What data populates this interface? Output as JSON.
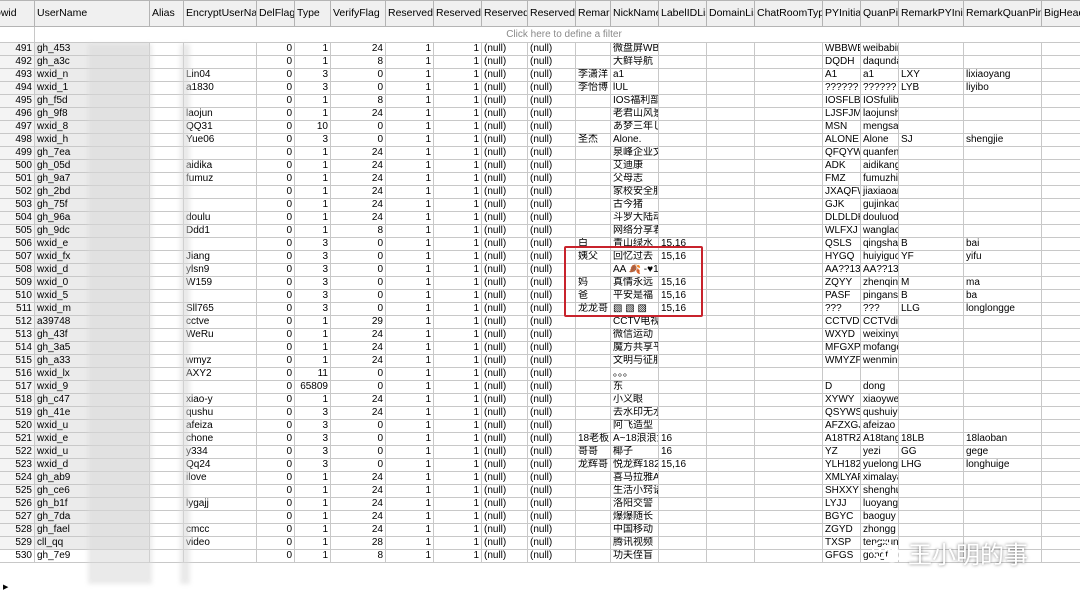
{
  "columns": [
    "owid",
    "UserName",
    "Alias",
    "EncryptUserName",
    "DelFlag",
    "Type",
    "VerifyFlag",
    "Reserved1",
    "Reserved2",
    "Reserved3",
    "Reserved4",
    "Remark",
    "NickName",
    "LabelIDList",
    "DomainList",
    "ChatRoomType",
    "PYInitial",
    "QuanPin",
    "RemarkPYInitial",
    "RemarkQuanPin",
    "BigHeadImgUrl"
  ],
  "filter_placeholder": "Click here to define a filter",
  "rows": [
    [
      "491",
      "gh_453",
      "",
      "",
      "0",
      "1",
      "24",
      "1",
      "1",
      "(null)",
      "(null)",
      "",
      "微盘屏WBP",
      "",
      "",
      "",
      "WBBWBI",
      "weibabir",
      "",
      "",
      ""
    ],
    [
      "492",
      "gh_a3c",
      "",
      "",
      "0",
      "1",
      "8",
      "1",
      "1",
      "(null)",
      "(null)",
      "",
      "大鲜导航",
      "",
      "",
      "",
      "DQDH",
      "daqunda",
      "",
      "",
      ""
    ],
    [
      "493",
      "wxid_n",
      "",
      "Lin04",
      "0",
      "3",
      "0",
      "1",
      "1",
      "(null)",
      "(null)",
      "李潇洋",
      "a1",
      "",
      "",
      "",
      "A1",
      "a1",
      "LXY",
      "lixiaoyang",
      ""
    ],
    [
      "494",
      "wxid_1",
      "",
      "a1830",
      "0",
      "3",
      "0",
      "1",
      "1",
      "(null)",
      "(null)",
      "李怡博",
      "lUL",
      "",
      "",
      "",
      "??????",
      "??????",
      "LYB",
      "liyibo",
      ""
    ],
    [
      "495",
      "gh_f5d",
      "",
      "",
      "0",
      "1",
      "8",
      "1",
      "1",
      "(null)",
      "(null)",
      "",
      "IOS福利部惊",
      "",
      "",
      "",
      "IOSFLBL",
      "IOSfulibu",
      "",
      "",
      ""
    ],
    [
      "496",
      "gh_9f8",
      "",
      "laojun",
      "0",
      "1",
      "24",
      "1",
      "1",
      "(null)",
      "(null)",
      "",
      "老君山风景",
      "",
      "",
      "",
      "LJSFJMS",
      "laojunsha",
      "",
      "",
      ""
    ],
    [
      "497",
      "wxid_8",
      "",
      "QQ31",
      "0",
      "10",
      "0",
      "1",
      "1",
      "(null)",
      "(null)",
      "",
      "あ梦三年じ",
      "",
      "",
      "",
      "MSN",
      "mengsar",
      "",
      "",
      ""
    ],
    [
      "498",
      "wxid_h",
      "",
      "Yue06",
      "0",
      "3",
      "0",
      "1",
      "1",
      "(null)",
      "(null)",
      "圣杰",
      "Alone.",
      "",
      "",
      "",
      "ALONE",
      "Alone",
      "SJ",
      "shengjie",
      ""
    ],
    [
      "499",
      "gh_7ea",
      "",
      "",
      "0",
      "1",
      "24",
      "1",
      "1",
      "(null)",
      "(null)",
      "",
      "泉峰企业文化",
      "",
      "",
      "",
      "QFQYWI",
      "quanfeng",
      "",
      "",
      ""
    ],
    [
      "500",
      "gh_05d",
      "",
      "aidika",
      "0",
      "1",
      "24",
      "1",
      "1",
      "(null)",
      "(null)",
      "",
      "艾迪康",
      "",
      "",
      "",
      "ADK",
      "aidikang",
      "",
      "",
      ""
    ],
    [
      "501",
      "gh_9a7",
      "",
      "fumuz",
      "0",
      "1",
      "24",
      "1",
      "1",
      "(null)",
      "(null)",
      "",
      "父母志",
      "",
      "",
      "",
      "FMZ",
      "fumuzhi",
      "",
      "",
      ""
    ],
    [
      "502",
      "gh_2bd",
      "",
      "",
      "0",
      "1",
      "24",
      "1",
      "1",
      "(null)",
      "(null)",
      "",
      "家校安全服务",
      "",
      "",
      "",
      "JXAQFW",
      "jiaxiaoan",
      "",
      "",
      ""
    ],
    [
      "503",
      "gh_75f",
      "",
      "",
      "0",
      "1",
      "24",
      "1",
      "1",
      "(null)",
      "(null)",
      "",
      "古今猪",
      "",
      "",
      "",
      "GJK",
      "gujinkao",
      "",
      "",
      ""
    ],
    [
      "504",
      "gh_96a",
      "",
      "doulu",
      "0",
      "1",
      "24",
      "1",
      "1",
      "(null)",
      "(null)",
      "",
      "斗罗大陆动",
      "",
      "",
      "",
      "DLDLDH",
      "douluod",
      "",
      "",
      ""
    ],
    [
      "505",
      "gh_9dc",
      "",
      "Ddd1",
      "0",
      "1",
      "8",
      "1",
      "1",
      "(null)",
      "(null)",
      "",
      "网络分享君",
      "",
      "",
      "",
      "WLFXJ",
      "wanglao",
      "",
      "",
      ""
    ],
    [
      "506",
      "wxid_e",
      "",
      "",
      "0",
      "3",
      "0",
      "1",
      "1",
      "(null)",
      "(null)",
      "白",
      "青山绿水",
      "15,16",
      "",
      "",
      "QSLS",
      "qingshar",
      "B",
      "bai",
      ""
    ],
    [
      "507",
      "wxid_fx",
      "",
      "Jiang",
      "0",
      "3",
      "0",
      "1",
      "1",
      "(null)",
      "(null)",
      "姨父",
      "回忆过去",
      "15,16",
      "",
      "",
      "HYGQ",
      "huiyiguo",
      "YF",
      "yifu",
      ""
    ],
    [
      "508",
      "wxid_d",
      "",
      "ylsn9",
      "0",
      "3",
      "0",
      "1",
      "1",
      "(null)",
      "(null)",
      "",
      "AA 🍂 -♥16",
      "",
      "",
      "",
      "AA??130",
      "AA??136",
      "",
      "",
      ""
    ],
    [
      "509",
      "wxid_0",
      "",
      "W159",
      "0",
      "3",
      "0",
      "1",
      "1",
      "(null)",
      "(null)",
      "妈",
      "真情永远",
      "15,16",
      "",
      "",
      "ZQYY",
      "zhenqing",
      "M",
      "ma",
      ""
    ],
    [
      "510",
      "wxid_5",
      "",
      "",
      "0",
      "3",
      "0",
      "1",
      "1",
      "(null)",
      "(null)",
      "爸",
      "平安是福",
      "15,16",
      "",
      "",
      "PASF",
      "pinganst",
      "B",
      "ba",
      ""
    ],
    [
      "511",
      "wxid_m",
      "",
      "Sll765",
      "0",
      "3",
      "0",
      "1",
      "1",
      "(null)",
      "(null)",
      "龙龙哥",
      "▧ ▧ ▧",
      "15,16",
      "",
      "",
      "???",
      "???",
      "LLG",
      "longlongge",
      ""
    ],
    [
      "512",
      "a39748",
      "",
      "cctve",
      "0",
      "1",
      "29",
      "1",
      "1",
      "(null)",
      "(null)",
      "",
      "CCTV电视剧",
      "",
      "",
      "",
      "CCTVDS",
      "CCTVdia",
      "",
      "",
      ""
    ],
    [
      "513",
      "gh_43f",
      "",
      "WeRu",
      "0",
      "1",
      "24",
      "1",
      "1",
      "(null)",
      "(null)",
      "",
      "微信运动",
      "",
      "",
      "",
      "WXYD",
      "weixinyu",
      "",
      "",
      ""
    ],
    [
      "514",
      "gh_3a5",
      "",
      "",
      "0",
      "1",
      "24",
      "1",
      "1",
      "(null)",
      "(null)",
      "",
      "魔方共享平台",
      "",
      "",
      "",
      "MFGXPT",
      "mofangc",
      "",
      "",
      ""
    ],
    [
      "515",
      "gh_a33",
      "",
      "wmyz",
      "0",
      "1",
      "24",
      "1",
      "1",
      "(null)",
      "(null)",
      "",
      "文明与征服",
      "",
      "",
      "",
      "WMYZF",
      "wenming",
      "",
      "",
      ""
    ],
    [
      "516",
      "wxid_lx",
      "",
      "AXY2",
      "0",
      "11",
      "0",
      "1",
      "1",
      "(null)",
      "(null)",
      "",
      "。。。",
      "",
      "",
      "",
      "",
      "",
      "",
      "",
      ""
    ],
    [
      "517",
      "wxid_9",
      "",
      "",
      "0",
      "65809",
      "0",
      "1",
      "1",
      "(null)",
      "(null)",
      "",
      "东",
      "",
      "",
      "",
      "D",
      "dong",
      "",
      "",
      ""
    ],
    [
      "518",
      "gh_c47",
      "",
      "xiao-y",
      "0",
      "1",
      "24",
      "1",
      "1",
      "(null)",
      "(null)",
      "",
      "小义眼",
      "",
      "",
      "",
      "XYWY",
      "xiaoywer",
      "",
      "",
      ""
    ],
    [
      "519",
      "gh_41e",
      "",
      "qushu",
      "0",
      "3",
      "24",
      "1",
      "1",
      "(null)",
      "(null)",
      "",
      "去水印无水印",
      "",
      "",
      "",
      "QSYWSY",
      "qushuiyi",
      "",
      "",
      ""
    ],
    [
      "520",
      "wxid_u",
      "",
      "afeiza",
      "0",
      "3",
      "0",
      "1",
      "1",
      "(null)",
      "(null)",
      "",
      "阿飞造型",
      "",
      "",
      "",
      "AFZXGJ",
      "afeizao",
      "",
      "",
      ""
    ],
    [
      "521",
      "wxid_e",
      "",
      "chone",
      "0",
      "3",
      "0",
      "1",
      "1",
      "(null)",
      "(null)",
      "18老板",
      "A~18浪浪油",
      "16",
      "",
      "",
      "A18TRZ",
      "A18tang",
      "18LB",
      "18laoban",
      ""
    ],
    [
      "522",
      "wxid_u",
      "",
      "y334",
      "0",
      "3",
      "0",
      "1",
      "1",
      "(null)",
      "(null)",
      "哥哥",
      "椰子",
      "16",
      "",
      "",
      "YZ",
      "yezi",
      "GG",
      "gege",
      ""
    ],
    [
      "523",
      "wxid_d",
      "",
      "Qq24",
      "0",
      "3",
      "0",
      "1",
      "1",
      "(null)",
      "(null)",
      "龙辉哥",
      "悦龙辉1821",
      "15,16",
      "",
      "",
      "YLH182",
      "yuelongh",
      "LHG",
      "longhuige",
      ""
    ],
    [
      "524",
      "gh_ab9",
      "",
      "ilove",
      "0",
      "1",
      "24",
      "1",
      "1",
      "(null)",
      "(null)",
      "",
      "喜马拉雅AP",
      "",
      "",
      "",
      "XMLYAF",
      "ximalaya",
      "",
      "",
      ""
    ],
    [
      "525",
      "gh_ce6",
      "",
      "",
      "0",
      "1",
      "24",
      "1",
      "1",
      "(null)",
      "(null)",
      "",
      "生活小窍语",
      "",
      "",
      "",
      "SHXXY",
      "shenghu",
      "",
      "",
      ""
    ],
    [
      "526",
      "gh_b1f",
      "",
      "lygajj",
      "0",
      "1",
      "24",
      "1",
      "1",
      "(null)",
      "(null)",
      "",
      "洛阳交警",
      "",
      "",
      "",
      "LYJJ",
      "luoyangj",
      "",
      "",
      ""
    ],
    [
      "527",
      "gh_7da",
      "",
      "",
      "0",
      "1",
      "24",
      "1",
      "1",
      "(null)",
      "(null)",
      "",
      "爆爆随长",
      "",
      "",
      "",
      "BGYC",
      "baoguy",
      "",
      "",
      ""
    ],
    [
      "528",
      "gh_fael",
      "",
      "cmcc",
      "0",
      "1",
      "24",
      "1",
      "1",
      "(null)",
      "(null)",
      "",
      "中国移动",
      "",
      "",
      "",
      "ZGYD",
      "zhongg",
      "",
      "",
      ""
    ],
    [
      "529",
      "cll_qq",
      "",
      "video",
      "0",
      "1",
      "28",
      "1",
      "1",
      "(null)",
      "(null)",
      "",
      "腾讯视频",
      "",
      "",
      "",
      "TXSP",
      "tengxun",
      "",
      "",
      ""
    ],
    [
      "530",
      "gh_7e9",
      "",
      "",
      "0",
      "1",
      "8",
      "1",
      "1",
      "(null)",
      "(null)",
      "",
      "功夫侄盲",
      "",
      "",
      "",
      "GFGS",
      "gongf",
      "",
      "",
      ""
    ]
  ],
  "highlight_color": "#c8232c",
  "watermark": {
    "icon": "wechat-icon",
    "text": "王小明的事"
  },
  "row_marker_icon": "current-row-triangle-icon"
}
